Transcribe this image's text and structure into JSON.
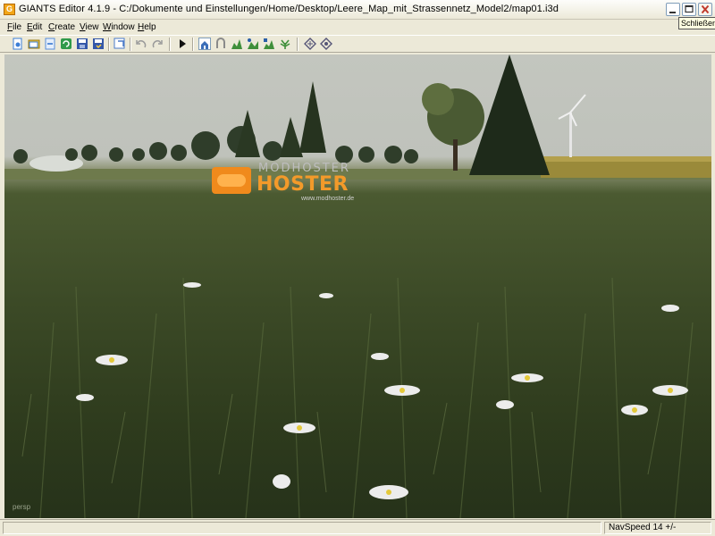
{
  "window": {
    "title": "GIANTS Editor 4.1.9 - C:/Dokumente und Einstellungen/Home/Desktop/Leere_Map_mit_Strassennetz_Model2/map01.i3d",
    "close_tooltip": "Schließen",
    "app_icon_letter": "G"
  },
  "menu": [
    {
      "label": "File",
      "accel": "F",
      "rest": "ile"
    },
    {
      "label": "Edit",
      "accel": "E",
      "rest": "dit"
    },
    {
      "label": "Create",
      "accel": "C",
      "rest": "reate"
    },
    {
      "label": "View",
      "accel": "V",
      "rest": "iew"
    },
    {
      "label": "Window",
      "accel": "W",
      "rest": "indow"
    },
    {
      "label": "Help",
      "accel": "H",
      "rest": "elp"
    }
  ],
  "toolbar": [
    {
      "name": "new-file-icon",
      "color": "#3d7fd6"
    },
    {
      "name": "open-folder-icon",
      "color": "#e8c040"
    },
    {
      "name": "import-icon",
      "color": "#5a8fd8"
    },
    {
      "name": "refresh-icon",
      "color": "#2f9a4a"
    },
    {
      "name": "save-icon",
      "color": "#3457a8"
    },
    {
      "name": "save-as-icon",
      "color": "#3457a8"
    },
    {
      "name": "export-icon",
      "color": "#4a7ac8"
    },
    {
      "name": "undo-icon",
      "color": "#9a9a9a"
    },
    {
      "name": "redo-icon",
      "color": "#9a9a9a"
    },
    {
      "name": "play-icon",
      "color": "#111111"
    },
    {
      "name": "select-mode-icon",
      "color": "#3d6fb8"
    },
    {
      "name": "move-mode-icon",
      "color": "#8a8a8a"
    },
    {
      "name": "terrain-sculpt-icon",
      "color": "#3f8f3a"
    },
    {
      "name": "terrain-paint-icon",
      "color": "#3f8f3a"
    },
    {
      "name": "terrain-smooth-icon",
      "color": "#3f8f3a"
    },
    {
      "name": "foliage-paint-icon",
      "color": "#3f8f3a"
    },
    {
      "name": "grid-settings-icon",
      "color": "#555577"
    },
    {
      "name": "snap-settings-icon",
      "color": "#555577"
    }
  ],
  "viewport": {
    "camera_label": "persp"
  },
  "watermark": {
    "top": "MODHOSTER",
    "brand": "HOSTER",
    "url": "www.modhoster.de"
  },
  "status": {
    "nav_speed": "NavSpeed 14 +/-"
  },
  "colors": {
    "sky": "#c3c6bf",
    "grass_dark": "#2e3b1d",
    "accent_orange": "#f08a1c",
    "chrome": "#ece9d8"
  }
}
